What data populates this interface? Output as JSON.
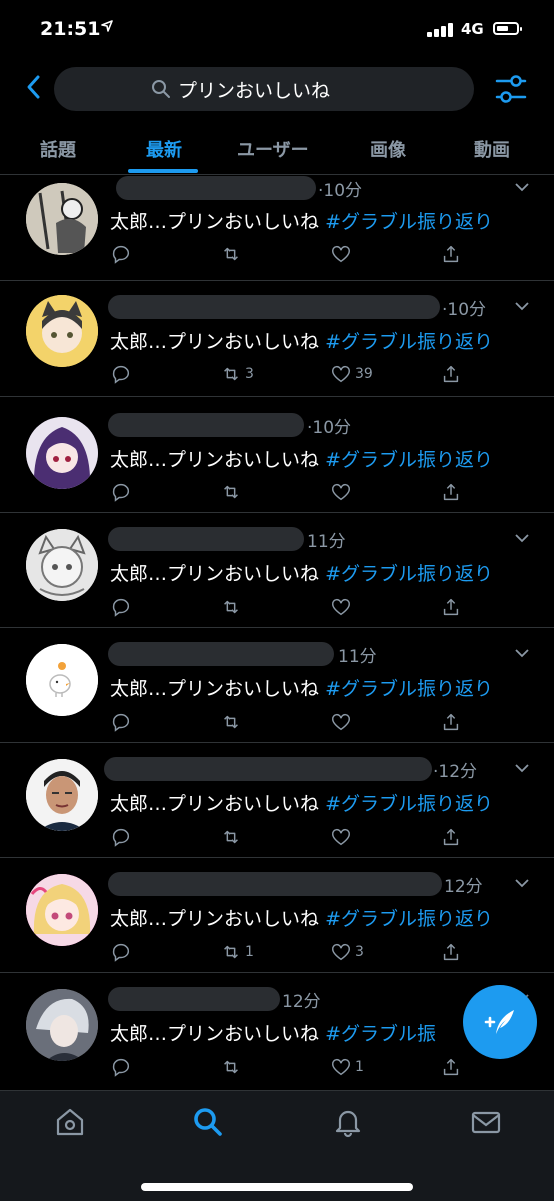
{
  "status_bar": {
    "time": "21:51",
    "location_icon": "location-arrow-icon",
    "network": "4G",
    "signal_icon": "cellular-signal-icon",
    "battery_icon": "battery-icon"
  },
  "search": {
    "query": "プリンおいしいね",
    "back_icon": "back-chevron-icon",
    "filter_icon": "sliders-icon"
  },
  "tabs": [
    {
      "label": "話題",
      "active": false
    },
    {
      "label": "最新",
      "active": true
    },
    {
      "label": "ユーザー",
      "active": false
    },
    {
      "label": "画像",
      "active": false
    },
    {
      "label": "動画",
      "active": false
    }
  ],
  "tweets": [
    {
      "time": "10分",
      "text_prefix": "太郎…プリンおいしいね",
      "hashtag": "#グラブル振り返り",
      "retweets": "",
      "likes": ""
    },
    {
      "time": "10分",
      "text_prefix": "太郎…プリンおいしいね",
      "hashtag": "#グラブル振り返り",
      "retweets": "3",
      "likes": "39"
    },
    {
      "time": "10分",
      "text_prefix": "太郎…プリンおいしいね",
      "hashtag": "#グラブル振り返り",
      "retweets": "",
      "likes": ""
    },
    {
      "time": "11分",
      "text_prefix": "太郎…プリンおいしいね",
      "hashtag": "#グラブル振り返り",
      "retweets": "",
      "likes": ""
    },
    {
      "time": "11分",
      "text_prefix": "太郎…プリンおいしいね",
      "hashtag": "#グラブル振り返り",
      "retweets": "",
      "likes": ""
    },
    {
      "time": "12分",
      "text_prefix": "太郎…プリンおいしいね",
      "hashtag": "#グラブル振り返り",
      "retweets": "",
      "likes": ""
    },
    {
      "time": "12分",
      "text_prefix": "太郎…プリンおいしいね",
      "hashtag": "#グラブル振り返り",
      "retweets": "1",
      "likes": "3"
    },
    {
      "time": "12分",
      "text_prefix": "太郎…プリンおいしいね",
      "hashtag": "#グラブル振",
      "retweets": "",
      "likes": "1"
    }
  ],
  "fab": {
    "icon": "compose-tweet-icon"
  },
  "bottom_nav": [
    "home-icon",
    "search-icon",
    "notifications-bell-icon",
    "messages-envelope-icon"
  ],
  "colors": {
    "accent": "#1d9bf0",
    "background": "#000000",
    "muted": "#8b98a5",
    "divider": "#2f3336"
  }
}
